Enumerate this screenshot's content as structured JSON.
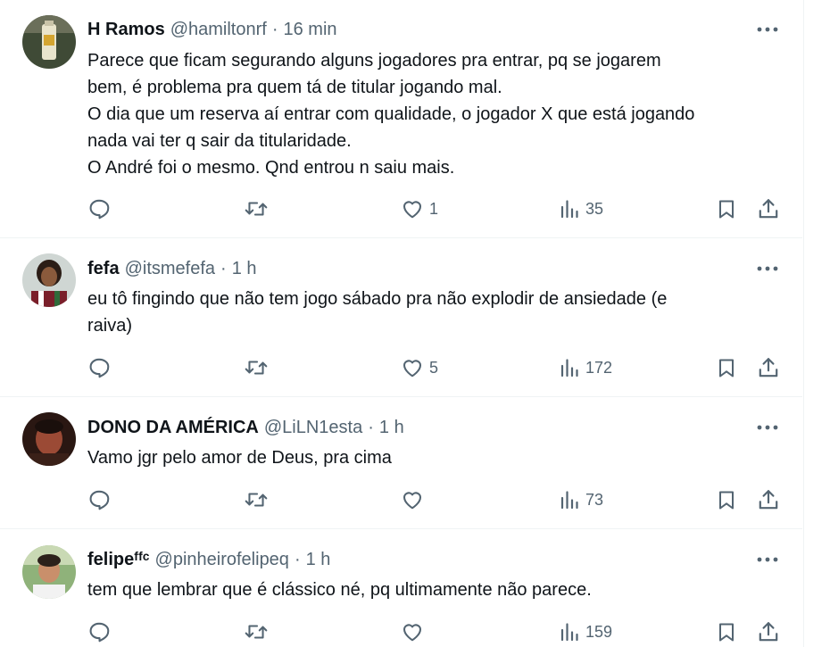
{
  "tweets": [
    {
      "name": "H Ramos",
      "handle": "@hamiltonrf",
      "separator": "·",
      "time": "16 min",
      "lines": [
        "Parece que ficam segurando alguns jogadores pra entrar, pq se jogarem",
        "bem, é problema pra quem tá de titular jogando mal.",
        "O dia que um reserva aí entrar com qualidade, o jogador X que está jogando",
        "nada vai ter q sair da titularidade.",
        "O André foi o mesmo. Qnd entrou n saiu mais."
      ],
      "replies": "",
      "retweets": "",
      "likes": "1",
      "views": "35"
    },
    {
      "name": "fefa",
      "handle": "@itsmefefa",
      "separator": "·",
      "time": "1 h",
      "lines": [
        "eu tô fingindo que não tem jogo sábado pra não explodir de ansiedade (e",
        "raiva)"
      ],
      "replies": "",
      "retweets": "",
      "likes": "5",
      "views": "172"
    },
    {
      "name": "DONO DA AMÉRICA",
      "handle": "@LiLN1esta",
      "separator": "·",
      "time": "1 h",
      "lines": [
        "Vamo jgr pelo amor de Deus, pra cima"
      ],
      "replies": "",
      "retweets": "",
      "likes": "",
      "views": "73"
    },
    {
      "name": "felipeᶠᶠᶜ",
      "handle": "@pinheirofelipeq",
      "separator": "·",
      "time": "1 h",
      "lines": [
        "tem que lembrar que é clássico né, pq ultimamente não parece."
      ],
      "replies": "",
      "retweets": "",
      "likes": "",
      "views": "159"
    }
  ],
  "icons": {
    "reply": "reply-icon",
    "retweet": "retweet-icon",
    "like": "heart-icon",
    "views": "views-chart-icon",
    "bookmark": "bookmark-icon",
    "share": "share-icon",
    "more": "more-dots-icon"
  },
  "colors": {
    "text": "#0f1419",
    "secondary": "#536471",
    "divider": "#eff3f4"
  }
}
